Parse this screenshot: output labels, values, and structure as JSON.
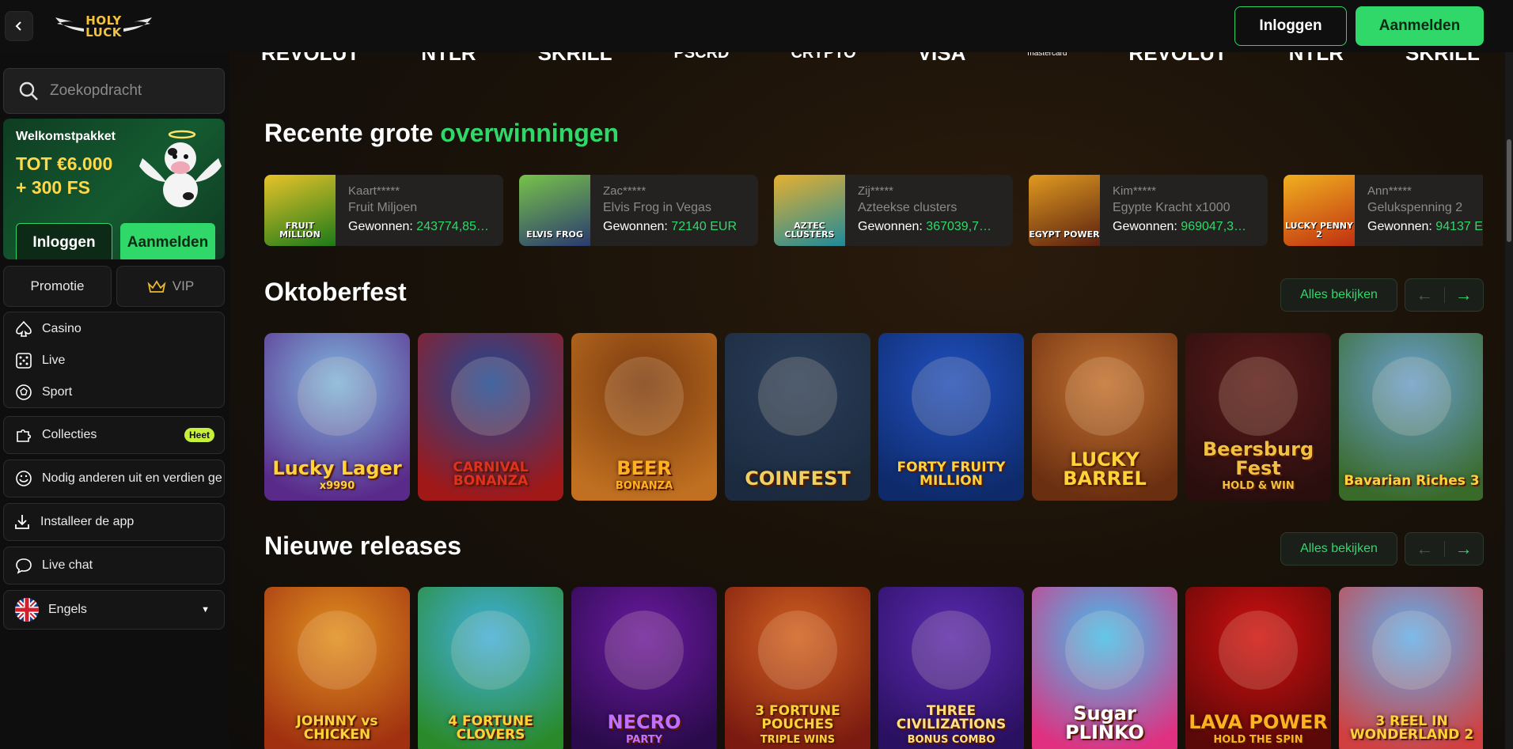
{
  "header": {
    "logo_text_line1": "HOLY",
    "logo_text_line2": "LUCK",
    "login_label": "Inloggen",
    "signup_label": "Aanmelden"
  },
  "sidebar": {
    "search_placeholder": "Zoekopdracht",
    "promo": {
      "title": "Welkomstpakket",
      "amount_line1": "TOT €6.000",
      "amount_line2": "+ 300 FS",
      "login_label": "Inloggen",
      "signup_label": "Aanmelden"
    },
    "tabs": {
      "promo": "Promotie",
      "vip": "VIP"
    },
    "nav": [
      {
        "label": "Casino",
        "icon": "spade-icon"
      },
      {
        "label": "Live",
        "icon": "dice-icon"
      },
      {
        "label": "Sport",
        "icon": "ball-icon"
      }
    ],
    "collections": {
      "label": "Collecties",
      "badge": "Heet"
    },
    "refer": "Nodig anderen uit en verdien ge",
    "install": "Installeer de app",
    "chat": "Live chat",
    "language": "Engels"
  },
  "payments": [
    "REVOLUT",
    "NTLR",
    "SKRILL",
    "PSCRD",
    "CRYPTO",
    "VISA",
    "mastercard",
    "REVOLUT",
    "NTLR",
    "SKRILL"
  ],
  "recent_wins": {
    "title_plain": "Recente grote",
    "title_accent": "overwinningen",
    "won_label": "Gewonnen:",
    "items": [
      {
        "user": "Kaart*****",
        "game": "Fruit Miljoen",
        "amount": "243774,85…",
        "thumb": "FRUIT MILLION",
        "color1": "#1c7a18",
        "color2": "#e8c32a"
      },
      {
        "user": "Zac*****",
        "game": "Elvis Frog in Vegas",
        "amount": "72140 EUR",
        "thumb": "ELVIS FROG",
        "color1": "#2a3a70",
        "color2": "#78c24a"
      },
      {
        "user": "Zij*****",
        "game": "Azteekse clusters",
        "amount": "367039,7…",
        "thumb": "AZTEC CLUSTERS",
        "color1": "#1e8a9a",
        "color2": "#e6b030"
      },
      {
        "user": "Kim*****",
        "game": "Egypte Kracht x1000",
        "amount": "969047,3…",
        "thumb": "EGYPT POWER",
        "color1": "#5a2010",
        "color2": "#e09a20"
      },
      {
        "user": "Ann*****",
        "game": "Gelukspenning 2",
        "amount": "94137 E",
        "thumb": "LUCKY PENNY 2",
        "color1": "#c03010",
        "color2": "#f0b020"
      }
    ]
  },
  "oktoberfest": {
    "title": "Oktoberfest",
    "see_all": "Alles bekijken",
    "games": [
      {
        "name": "Lucky Lager",
        "sub": "x9990",
        "c1": "#7fb8e0",
        "c2": "#5a2a8a",
        "text": "#ffd23a"
      },
      {
        "name": "CARNIVAL BONANZA",
        "sub": "",
        "c1": "#1b4a9a",
        "c2": "#a01818",
        "text": "#e03020"
      },
      {
        "name": "BEER",
        "sub": "BONANZA",
        "c1": "#7a3a10",
        "c2": "#c07020",
        "text": "#ffb020"
      },
      {
        "name": "COINFEST",
        "sub": "",
        "c1": "#2a3e5a",
        "c2": "#1b2a3e",
        "text": "#f0d060"
      },
      {
        "name": "FORTY FRUITY MILLION",
        "sub": "",
        "c1": "#2050c0",
        "c2": "#0e2a6a",
        "text": "#ffd23a"
      },
      {
        "name": "LUCKY BARREL",
        "sub": "",
        "c1": "#c07030",
        "c2": "#6a2e10",
        "text": "#ffd23a"
      },
      {
        "name": "Beersburg Fest",
        "sub": "HOLD & WIN",
        "c1": "#5a1a1a",
        "c2": "#2a0e0e",
        "text": "#f0c040"
      },
      {
        "name": "Bavarian Riches 3",
        "sub": "",
        "c1": "#6aa0d0",
        "c2": "#3a6a2a",
        "text": "#ffd23a"
      }
    ]
  },
  "new_releases": {
    "title": "Nieuwe releases",
    "see_all": "Alles bekijken",
    "games": [
      {
        "name": "JOHNNY vs CHICKEN",
        "sub": "",
        "c1": "#e09020",
        "c2": "#a03010",
        "text": "#ffd23a"
      },
      {
        "name": "4 FORTUNE CLOVERS",
        "sub": "",
        "c1": "#40b0e0",
        "c2": "#2a8a2a",
        "text": "#ffd23a"
      },
      {
        "name": "NECRO",
        "sub": "PARTY",
        "c1": "#6a1aa0",
        "c2": "#2a0a4a",
        "text": "#c070ff"
      },
      {
        "name": "3 FORTUNE POUCHES",
        "sub": "TRIPLE WINS",
        "c1": "#d06020",
        "c2": "#7a1a10",
        "text": "#ffd23a"
      },
      {
        "name": "THREE CIVILIZATIONS",
        "sub": "BONUS COMBO",
        "c1": "#5a2ab0",
        "c2": "#2a1060",
        "text": "#ffe080"
      },
      {
        "name": "Sugar PLINKO",
        "sub": "",
        "c1": "#40c0f0",
        "c2": "#e03080",
        "text": "#ffffff"
      },
      {
        "name": "LAVA POWER",
        "sub": "HOLD THE SPIN",
        "c1": "#d01010",
        "c2": "#5a0808",
        "text": "#ffb020"
      },
      {
        "name": "3 REEL IN WONDERLAND 2",
        "sub": "",
        "c1": "#60b0f0",
        "c2": "#d04040",
        "text": "#ffd23a"
      }
    ]
  },
  "colors": {
    "accent": "#30d86a",
    "badge": "#c7f03c",
    "gold": "#ffd84a"
  }
}
